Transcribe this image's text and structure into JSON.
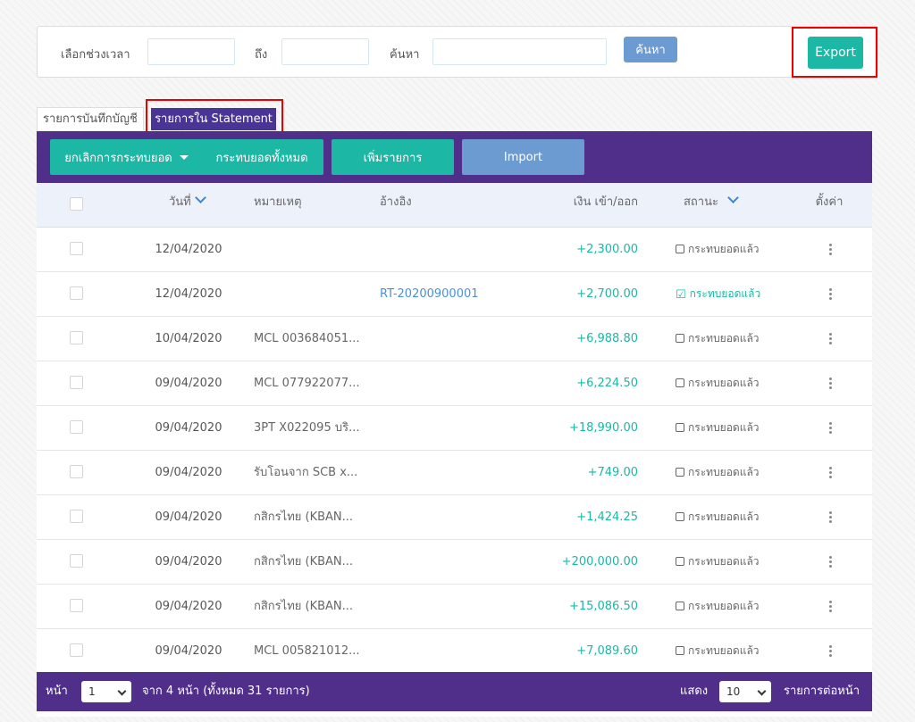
{
  "filter": {
    "period_label": "เลือกช่วงเวลา",
    "to_label": "ถึง",
    "search_label": "ค้นหา",
    "search_button": "ค้นหา",
    "export_button": "Export"
  },
  "tabs": [
    {
      "label": "รายการบันทึกบัญชี",
      "active": false
    },
    {
      "label": "รายการใน Statement",
      "active": true
    }
  ],
  "toolbar": {
    "unreconcile": "ยกเลิกการกระทบยอด",
    "reconcile_all": "กระทบยอดทั้งหมด",
    "add_item": "เพิ่มรายการ",
    "import": "Import"
  },
  "table": {
    "headers": {
      "date": "วันที่",
      "note": "หมายเหตุ",
      "ref": "อ้างอิง",
      "amount": "เงิน เข้า/ออก",
      "status": "สถานะ",
      "settings": "ตั้งค่า"
    },
    "rows": [
      {
        "date": "12/04/2020",
        "note": "",
        "ref": "",
        "amount": "+2,300.00",
        "status": "กระทบยอดแล้ว",
        "checked": false
      },
      {
        "date": "12/04/2020",
        "note": "",
        "ref": "RT-20200900001",
        "amount": "+2,700.00",
        "status": "กระทบยอดแล้ว",
        "checked": true
      },
      {
        "date": "10/04/2020",
        "note": "MCL 003684051...",
        "ref": "",
        "amount": "+6,988.80",
        "status": "กระทบยอดแล้ว",
        "checked": false
      },
      {
        "date": "09/04/2020",
        "note": "MCL 077922077...",
        "ref": "",
        "amount": "+6,224.50",
        "status": "กระทบยอดแล้ว",
        "checked": false
      },
      {
        "date": "09/04/2020",
        "note": "3PT X022095 บริ...",
        "ref": "",
        "amount": "+18,990.00",
        "status": "กระทบยอดแล้ว",
        "checked": false
      },
      {
        "date": "09/04/2020",
        "note": "รับโอนจาก SCB x...",
        "ref": "",
        "amount": "+749.00",
        "status": "กระทบยอดแล้ว",
        "checked": false
      },
      {
        "date": "09/04/2020",
        "note": "กสิกรไทย (KBAN...",
        "ref": "",
        "amount": "+1,424.25",
        "status": "กระทบยอดแล้ว",
        "checked": false
      },
      {
        "date": "09/04/2020",
        "note": "กสิกรไทย (KBAN...",
        "ref": "",
        "amount": "+200,000.00",
        "status": "กระทบยอดแล้ว",
        "checked": false
      },
      {
        "date": "09/04/2020",
        "note": "กสิกรไทย (KBAN...",
        "ref": "",
        "amount": "+15,086.50",
        "status": "กระทบยอดแล้ว",
        "checked": false
      },
      {
        "date": "09/04/2020",
        "note": "MCL 005821012...",
        "ref": "",
        "amount": "+7,089.60",
        "status": "กระทบยอดแล้ว",
        "checked": false
      }
    ]
  },
  "pagination": {
    "page_label": "หน้า",
    "page_value": "1",
    "summary": "จาก 4 หน้า (ทั้งหมด 31 รายการ)",
    "show_label": "แสดง",
    "per_page_value": "10",
    "per_page_suffix": "รายการต่อหน้า"
  },
  "colors": {
    "purple": "#4f2f8a",
    "teal": "#1cb7a5",
    "blue": "#6c9bd2"
  }
}
